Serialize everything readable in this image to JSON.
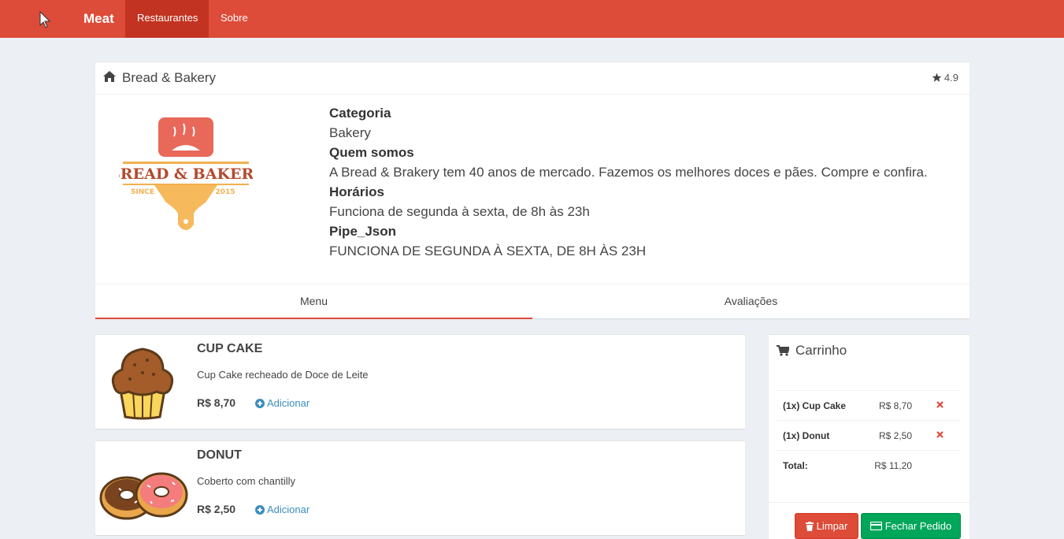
{
  "navbar": {
    "brand": "Meat",
    "links": [
      "Restaurantes",
      "Sobre"
    ]
  },
  "restaurant": {
    "name": "Bread & Bakery",
    "rating": "4.9",
    "logo": {
      "title": "BREAD & BAKERY",
      "since": "SINCE",
      "year": "2015"
    },
    "info": [
      {
        "label": "Categoria",
        "value": "Bakery"
      },
      {
        "label": "Quem somos",
        "value": "A Bread & Brakery tem 40 anos de mercado. Fazemos os melhores doces e pães. Compre e confira."
      },
      {
        "label": "Horários",
        "value": "Funciona de segunda à sexta, de 8h às 23h"
      },
      {
        "label": "Pipe_Json",
        "value": "FUNCIONA DE SEGUNDA À SEXTA, DE 8H ÀS 23H"
      }
    ],
    "tabs": [
      "Menu",
      "Avaliações"
    ]
  },
  "menu": [
    {
      "name": "CUP CAKE",
      "description": "Cup Cake recheado de Doce de Leite",
      "price": "R$ 8,70",
      "action": "Adicionar"
    },
    {
      "name": "DONUT",
      "description": "Coberto com chantilly",
      "price": "R$ 2,50",
      "action": "Adicionar"
    }
  ],
  "cart": {
    "title": "Carrinho",
    "items": [
      {
        "name": "(1x) Cup Cake",
        "price": "R$ 8,70"
      },
      {
        "name": "(1x) Donut",
        "price": "R$ 2,50"
      }
    ],
    "total_label": "Total:",
    "total_value": "R$ 11,20",
    "clear_label": "Limpar",
    "checkout_label": "Fechar Pedido"
  },
  "colors": {
    "navbar": "#dd4b39",
    "link": "#3c8dbc",
    "success": "#00a65a",
    "danger": "#dd4b39"
  },
  "icons": [
    "home-icon",
    "star-icon",
    "plus-circle-icon",
    "shopping-cart-icon",
    "remove-icon",
    "trash-icon",
    "credit-card-icon"
  ]
}
